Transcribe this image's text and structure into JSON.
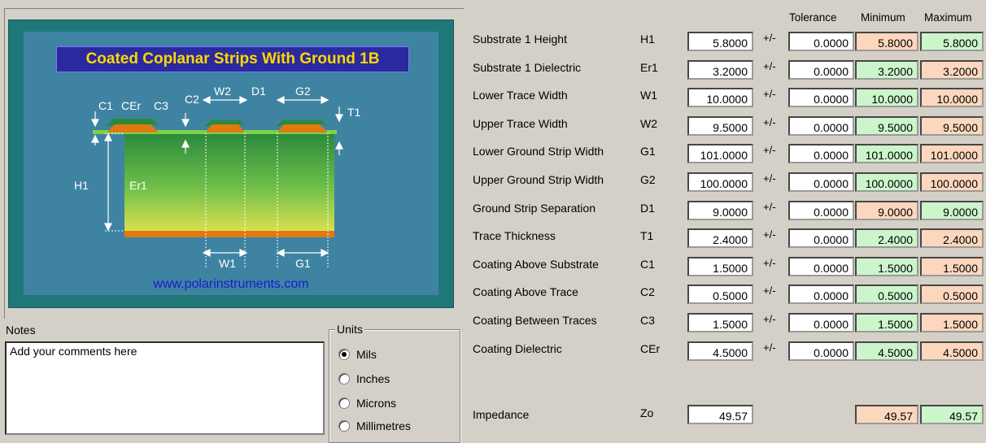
{
  "diagram": {
    "title": "Coated Coplanar Strips With Ground 1B",
    "url": "www.polarinstruments.com",
    "labels": {
      "c1": "C1",
      "cer": "CEr",
      "c3": "C3",
      "c2": "C2",
      "w2": "W2",
      "d1": "D1",
      "g2": "G2",
      "t1": "T1",
      "h1": "H1",
      "er1": "Er1",
      "w1": "W1",
      "g1": "G1"
    }
  },
  "notes": {
    "label": "Notes",
    "text": "Add your comments here"
  },
  "units": {
    "legend": "Units",
    "options": [
      "Mils",
      "Inches",
      "Microns",
      "Millimetres"
    ],
    "selected": "Mils"
  },
  "headers": {
    "tolerance": "Tolerance",
    "minimum": "Minimum",
    "maximum": "Maximum"
  },
  "pm_symbol": "+/-",
  "params": [
    {
      "label": "Substrate 1 Height",
      "sym": "H1",
      "value": "5.8000",
      "tol": "0.0000",
      "min": "5.8000",
      "max": "5.8000",
      "min_color": "peach",
      "max_color": "green"
    },
    {
      "label": "Substrate 1 Dielectric",
      "sym": "Er1",
      "value": "3.2000",
      "tol": "0.0000",
      "min": "3.2000",
      "max": "3.2000",
      "min_color": "green",
      "max_color": "peach"
    },
    {
      "label": "Lower Trace Width",
      "sym": "W1",
      "value": "10.0000",
      "tol": "0.0000",
      "min": "10.0000",
      "max": "10.0000",
      "min_color": "green",
      "max_color": "peach"
    },
    {
      "label": "Upper Trace Width",
      "sym": "W2",
      "value": "9.5000",
      "tol": "0.0000",
      "min": "9.5000",
      "max": "9.5000",
      "min_color": "green",
      "max_color": "peach"
    },
    {
      "label": "Lower Ground Strip Width",
      "sym": "G1",
      "value": "101.0000",
      "tol": "0.0000",
      "min": "101.0000",
      "max": "101.0000",
      "min_color": "green",
      "max_color": "peach"
    },
    {
      "label": "Upper Ground Strip Width",
      "sym": "G2",
      "value": "100.0000",
      "tol": "0.0000",
      "min": "100.0000",
      "max": "100.0000",
      "min_color": "green",
      "max_color": "peach"
    },
    {
      "label": "Ground Strip Separation",
      "sym": "D1",
      "value": "9.0000",
      "tol": "0.0000",
      "min": "9.0000",
      "max": "9.0000",
      "min_color": "peach",
      "max_color": "green"
    },
    {
      "label": "Trace Thickness",
      "sym": "T1",
      "value": "2.4000",
      "tol": "0.0000",
      "min": "2.4000",
      "max": "2.4000",
      "min_color": "green",
      "max_color": "peach"
    },
    {
      "label": "Coating Above Substrate",
      "sym": "C1",
      "value": "1.5000",
      "tol": "0.0000",
      "min": "1.5000",
      "max": "1.5000",
      "min_color": "green",
      "max_color": "peach"
    },
    {
      "label": "Coating Above Trace",
      "sym": "C2",
      "value": "0.5000",
      "tol": "0.0000",
      "min": "0.5000",
      "max": "0.5000",
      "min_color": "green",
      "max_color": "peach"
    },
    {
      "label": "Coating Between Traces",
      "sym": "C3",
      "value": "1.5000",
      "tol": "0.0000",
      "min": "1.5000",
      "max": "1.5000",
      "min_color": "green",
      "max_color": "peach"
    },
    {
      "label": "Coating Dielectric",
      "sym": "CEr",
      "value": "4.5000",
      "tol": "0.0000",
      "min": "4.5000",
      "max": "4.5000",
      "min_color": "green",
      "max_color": "peach"
    }
  ],
  "impedance": {
    "label": "Impedance",
    "sym": "Zo",
    "value": "49.57",
    "min": "49.57",
    "max": "49.57",
    "min_color": "peach",
    "max_color": "green"
  },
  "colors": {
    "green": "#ccf5cc",
    "peach": "#fcd7bd"
  }
}
